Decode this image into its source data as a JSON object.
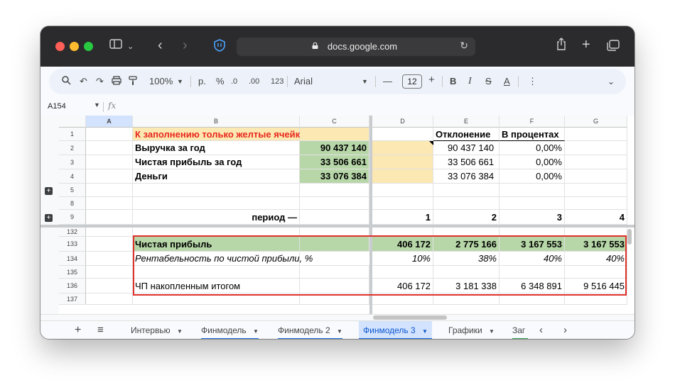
{
  "browser": {
    "url": "docs.google.com"
  },
  "toolbar": {
    "zoom": "100%",
    "currency": "р.",
    "percent": "%",
    "dec_decrease": ".0",
    "dec_increase": ".00",
    "format_123": "123",
    "font": "Arial",
    "font_size": "12",
    "minus": "—",
    "plus": "+",
    "bold": "B",
    "italic": "I",
    "strike": "S",
    "text_color": "A",
    "more": "⋮"
  },
  "formula_bar": {
    "cell_ref": "A154",
    "fx": "fx"
  },
  "columns": [
    "A",
    "B",
    "C",
    "D",
    "E",
    "F",
    "G"
  ],
  "rows": {
    "r1": {
      "num": "1",
      "B": "К заполнению только желтые ячейки!",
      "E": "Отклонение",
      "F": "В процентах"
    },
    "r2": {
      "num": "2",
      "B": "Выручка за год",
      "C": "90 437 140",
      "E": "90 437 140",
      "F": "0,00%"
    },
    "r3": {
      "num": "3",
      "B": "Чистая прибыль за год",
      "C": "33 506 661",
      "E": "33 506 661",
      "F": "0,00%"
    },
    "r4": {
      "num": "4",
      "B": "Деньги",
      "C": "33 076 384",
      "E": "33 076 384",
      "F": "0,00%"
    },
    "r5": {
      "num": "5"
    },
    "r8": {
      "num": "8"
    },
    "r9": {
      "num": "9",
      "B": "период —",
      "D": "1",
      "E": "2",
      "F": "3",
      "G": "4"
    },
    "r132": {
      "num": "132"
    },
    "r133": {
      "num": "133",
      "B": "Чистая прибыль",
      "D": "406 172",
      "E": "2 775 166",
      "F": "3 167 553",
      "G": "3 167 553"
    },
    "r134": {
      "num": "134",
      "B": "Рентабельность по чистой прибыли, %",
      "D": "10%",
      "E": "38%",
      "F": "40%",
      "G": "40%"
    },
    "r135": {
      "num": "135"
    },
    "r136": {
      "num": "136",
      "B": "ЧП накопленным итогом",
      "D": "406 172",
      "E": "3 181 338",
      "F": "6 348 891",
      "G": "9 516 445"
    },
    "r137": {
      "num": "137"
    }
  },
  "tabs": [
    {
      "label": "Интервью"
    },
    {
      "label": "Финмодель"
    },
    {
      "label": "Финмодель 2"
    },
    {
      "label": "Финмодель 3"
    },
    {
      "label": "Графики"
    },
    {
      "label": "Заг"
    }
  ],
  "colors": {
    "yellow_cell": "#fce8b2",
    "green_cell": "#b7d7a8",
    "red_text": "#e8271d",
    "highlight_box": "#e0312a",
    "active_tab": "#0b57d0"
  }
}
